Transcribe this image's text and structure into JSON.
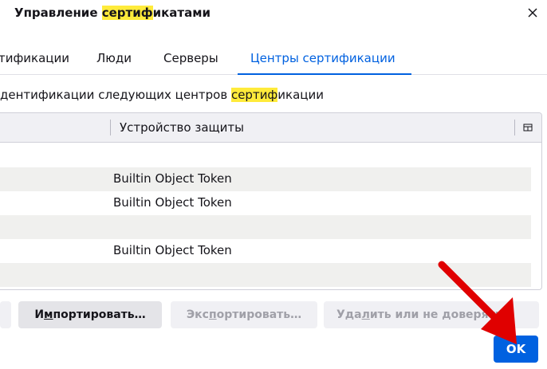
{
  "dialog": {
    "title_pre": "Управление ",
    "title_hl": "сертиф",
    "title_post": "икатами",
    "close_icon": "close-icon"
  },
  "tabs": [
    {
      "label": "тификации"
    },
    {
      "label": "Люди"
    },
    {
      "label": "Серверы"
    },
    {
      "label": "Центры сертификации",
      "selected": true
    }
  ],
  "description": {
    "pre": "дентификации следующих центров ",
    "hl": "сертиф",
    "post": "икации"
  },
  "table": {
    "column_device": "Устройство защиты",
    "column_picker_icon": "column-picker-icon",
    "rows": [
      "",
      "Builtin Object Token",
      "Builtin Object Token",
      "",
      "Builtin Object Token",
      ""
    ]
  },
  "buttons": {
    "import_pre": "И",
    "import_accel": "м",
    "import_post": "портировать…",
    "export_pre": "Экс",
    "export_accel": "п",
    "export_post": "ортировать…",
    "delete_pre": "Уда",
    "delete_accel": "л",
    "delete_post": "ить или не доверять…",
    "ok": "OK"
  },
  "colors": {
    "accent": "#0061e0",
    "highlight": "#ffeb3b",
    "annotation_arrow": "#e00000"
  }
}
